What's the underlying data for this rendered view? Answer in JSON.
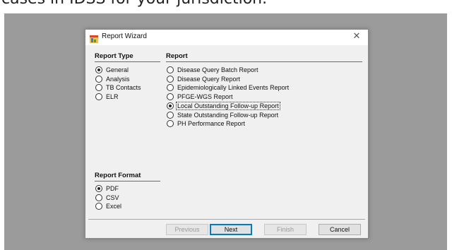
{
  "background_text": "cases in IDSS for your jurisdiction.",
  "dialog": {
    "title": "Report Wizard",
    "close_glyph": "✕"
  },
  "report_type": {
    "heading": "Report Type",
    "options": [
      "General",
      "Analysis",
      "TB Contacts",
      "ELR"
    ],
    "selected": "General"
  },
  "report": {
    "heading": "Report",
    "options": [
      "Disease Query Batch Report",
      "Disease Query Report",
      "Epidemiologically Linked Events Report",
      "PFGE-WGS Report",
      "Local Outstanding Follow-up Report",
      "State Outstanding Follow-up Report",
      "PH Performance Report"
    ],
    "selected": "Local Outstanding Follow-up Report"
  },
  "report_format": {
    "heading": "Report Format",
    "options": [
      "PDF",
      "CSV",
      "Excel"
    ],
    "selected": "PDF"
  },
  "buttons": {
    "previous": "Previous",
    "next": "Next",
    "finish": "Finish",
    "cancel": "Cancel"
  },
  "icons": {
    "app": "report-wizard-app-icon",
    "close": "close-icon"
  },
  "colors": {
    "backdrop": "#9b9b9b",
    "dialog_bg": "#f0f0f0",
    "default_button_border": "#0078d7"
  }
}
